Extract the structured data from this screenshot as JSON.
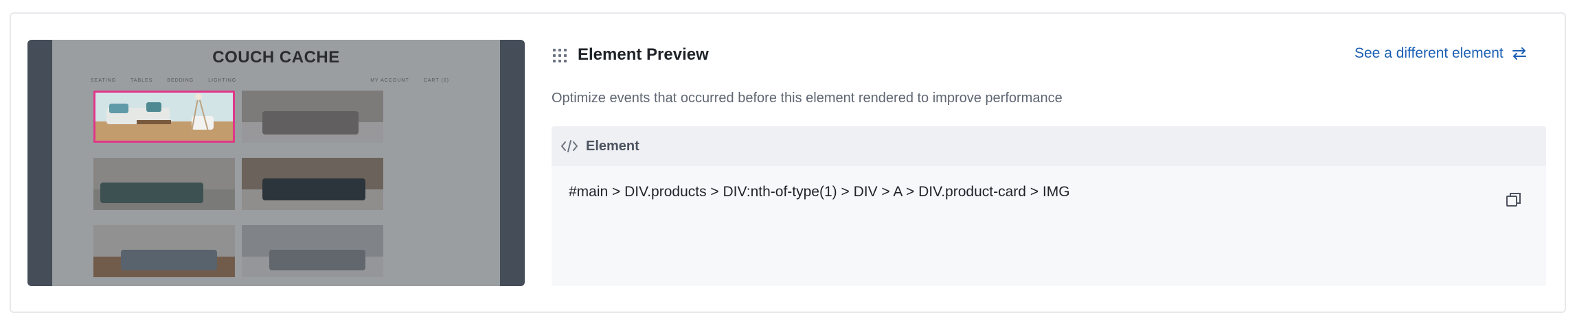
{
  "thumbnail": {
    "site_title": "COUCH CACHE",
    "nav_left": [
      "SEATING",
      "TABLES",
      "BEDDING",
      "LIGHTING"
    ],
    "nav_right": [
      "MY ACCOUNT",
      "CART (0)"
    ],
    "highlight_color": "#e0368a"
  },
  "preview": {
    "icon": "drag-grid-icon",
    "title": "Element Preview",
    "see_different_label": "See a different element",
    "see_different_icon": "swap-arrows-icon",
    "description": "Optimize events that occurred before this element rendered to improve performance"
  },
  "element": {
    "icon": "code-icon",
    "label": "Element",
    "selector": "#main > DIV.products > DIV:nth-of-type(1) > DIV > A > DIV.product-card > IMG",
    "copy_icon": "copy-icon"
  },
  "colors": {
    "link": "#1a5fb4",
    "title": "#1f2328",
    "muted": "#5f6672",
    "panel_header": "#eff0f3",
    "panel_body": "#f7f8fa"
  }
}
